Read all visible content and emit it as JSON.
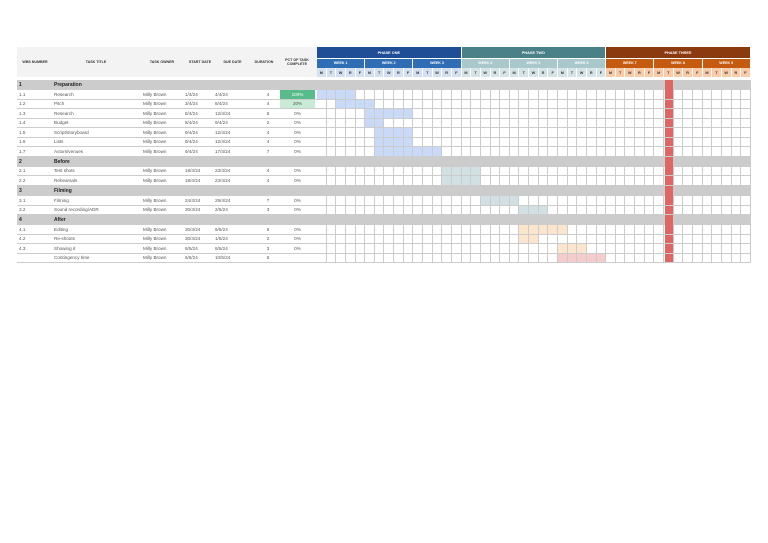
{
  "columns": {
    "wbs": "WBS NUMBER",
    "title": "TASK TITLE",
    "owner": "TASK OWNER",
    "start": "START DATE",
    "due": "DUE DATE",
    "duration": "DURATION",
    "pct": "PCT OF TASK COMPLETE"
  },
  "phases": [
    {
      "label": "PHASE ONE",
      "color": "#1f4e96",
      "week_color": "#2f6db5",
      "day_color": "#d3e0f2",
      "bar_color": "#c9daf8",
      "text": "#fff"
    },
    {
      "label": "PHASE TWO",
      "color": "#4a8087",
      "week_color": "#a8c8cb",
      "day_color": "#d5e5e7",
      "bar_color": "#d0e0e3",
      "text": "#fff"
    },
    {
      "label": "PHASE THREE",
      "color": "#8b3a0f",
      "week_color": "#c55a11",
      "day_color": "#f9cba8",
      "bar_color": "#fce5cd",
      "text": "#fff"
    }
  ],
  "weeks": [
    "WEEK 1",
    "WEEK 2",
    "WEEK 3",
    "WEEK 4",
    "WEEK 5",
    "WEEK 6",
    "WEEK 7",
    "WEEK 8",
    "WEEK 9"
  ],
  "days": [
    "M",
    "T",
    "W",
    "R",
    "F"
  ],
  "today_column": 36,
  "today_color": "#e06666",
  "rows": [
    {
      "type": "section",
      "wbs": "1",
      "title": "Preparation"
    },
    {
      "wbs": "1.1",
      "title": "Research",
      "owner": "Milly Brown",
      "start": "1/4/24",
      "due": "4/4/24",
      "duration": "4",
      "pct": "100%",
      "pct_value": 100,
      "bar": [
        0,
        3
      ],
      "phase": 0
    },
    {
      "wbs": "1.2",
      "title": "Pitch",
      "owner": "Milly Brown",
      "start": "3/4/24",
      "due": "8/4/24",
      "duration": "4",
      "pct": "30%",
      "pct_value": 30,
      "bar": [
        2,
        5
      ],
      "phase": 0
    },
    {
      "wbs": "1.3",
      "title": "Research",
      "owner": "Milly Brown",
      "start": "8/4/24",
      "due": "12/4/24",
      "duration": "5",
      "pct": "0%",
      "pct_value": 0,
      "bar": [
        5,
        9
      ],
      "phase": 0
    },
    {
      "wbs": "1.4",
      "title": "Budget",
      "owner": "Milly Brown",
      "start": "8/4/24",
      "due": "9/4/24",
      "duration": "2",
      "pct": "0%",
      "pct_value": 0,
      "bar": [
        5,
        6
      ],
      "phase": 0
    },
    {
      "wbs": "1.5",
      "title": "Script/storyboard",
      "owner": "Milly Brown",
      "start": "9/4/24",
      "due": "12/4/24",
      "duration": "4",
      "pct": "0%",
      "pct_value": 0,
      "bar": [
        6,
        9
      ],
      "phase": 0
    },
    {
      "wbs": "1.6",
      "title": "Lists",
      "owner": "Milly Brown",
      "start": "9/4/24",
      "due": "12/4/24",
      "duration": "4",
      "pct": "0%",
      "pct_value": 0,
      "bar": [
        6,
        9
      ],
      "phase": 0
    },
    {
      "wbs": "1.7",
      "title": "Actors/venues",
      "owner": "Milly Brown",
      "start": "9/4/24",
      "due": "17/4/24",
      "duration": "7",
      "pct": "0%",
      "pct_value": 0,
      "bar": [
        6,
        12
      ],
      "phase": 0
    },
    {
      "type": "section",
      "wbs": "2",
      "title": "Before"
    },
    {
      "wbs": "2.1",
      "title": "Test shots",
      "owner": "Milly Brown",
      "start": "18/4/24",
      "due": "23/4/24",
      "duration": "4",
      "pct": "0%",
      "pct_value": 0,
      "bar": [
        13,
        16
      ],
      "phase": 1
    },
    {
      "wbs": "2.2",
      "title": "Rehearsals",
      "owner": "Milly Brown",
      "start": "18/4/24",
      "due": "23/4/24",
      "duration": "4",
      "pct": "0%",
      "pct_value": 0,
      "bar": [
        13,
        16
      ],
      "phase": 1
    },
    {
      "type": "section",
      "wbs": "3",
      "title": "Filming"
    },
    {
      "wbs": "3.1",
      "title": "Filming",
      "owner": "Milly Brown",
      "start": "24/4/24",
      "due": "29/4/24",
      "duration": "7",
      "pct": "0%",
      "pct_value": 0,
      "bar": [
        17,
        20
      ],
      "phase": 1
    },
    {
      "wbs": "3.2",
      "title": "Sound recording/ADR",
      "owner": "Milly Brown",
      "start": "30/4/24",
      "due": "2/5/24",
      "duration": "3",
      "pct": "0%",
      "pct_value": 0,
      "bar": [
        21,
        23
      ],
      "phase": 1
    },
    {
      "type": "section",
      "wbs": "4",
      "title": "After"
    },
    {
      "wbs": "4.1",
      "title": "Editing",
      "owner": "Milly Brown",
      "start": "30/4/24",
      "due": "6/5/24",
      "duration": "5",
      "pct": "0%",
      "pct_value": 0,
      "bar": [
        21,
        25
      ],
      "phase": 2
    },
    {
      "wbs": "4.2",
      "title": "Re-shoots",
      "owner": "Milly Brown",
      "start": "30/4/24",
      "due": "1/5/24",
      "duration": "2",
      "pct": "0%",
      "pct_value": 0,
      "bar": [
        21,
        22
      ],
      "phase": 2
    },
    {
      "wbs": "4.3",
      "title": "Showing it",
      "owner": "Milly Brown",
      "start": "6/5/24",
      "due": "8/5/24",
      "duration": "3",
      "pct": "0%",
      "pct_value": 0,
      "bar": [
        25,
        27
      ],
      "phase": 2
    },
    {
      "wbs": "",
      "title": "Contingency time",
      "owner": "Milly Brown",
      "start": "6/5/24",
      "due": "10/5/24",
      "duration": "5",
      "pct": "",
      "bar": [
        25,
        29
      ],
      "phase": 2,
      "bar_color": "#f4cccc"
    }
  ]
}
